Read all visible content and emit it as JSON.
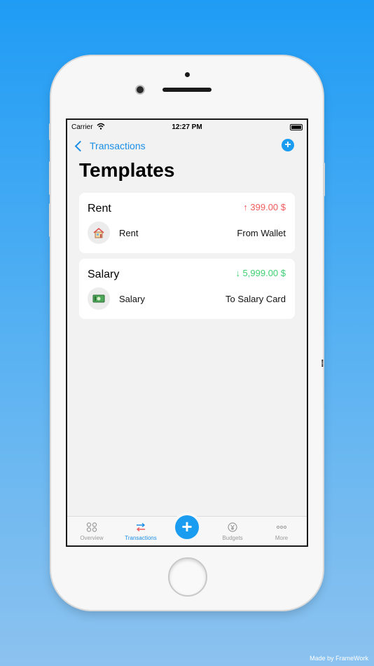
{
  "status_bar": {
    "carrier": "Carrier",
    "time": "12:27 PM"
  },
  "nav": {
    "back_label": "Transactions",
    "add_glyph": "+"
  },
  "page": {
    "title": "Templates"
  },
  "templates": [
    {
      "name": "Rent",
      "amount": "↑ 399.00 $",
      "direction": "out",
      "icon": "house-icon",
      "category": "Rent",
      "account": "From Wallet"
    },
    {
      "name": "Salary",
      "amount": "↓ 5,999.00 $",
      "direction": "in",
      "icon": "cash-icon",
      "category": "Salary",
      "account": "To Salary Card"
    }
  ],
  "tabbar": {
    "overview": "Overview",
    "transactions": "Transactions",
    "budgets": "Budgets",
    "more": "More",
    "fab_glyph": "+"
  },
  "watermark": "Made by FrameWork",
  "colors": {
    "accent": "#1a9cf0",
    "expense": "#ef5b5b",
    "income": "#3ecf73"
  }
}
